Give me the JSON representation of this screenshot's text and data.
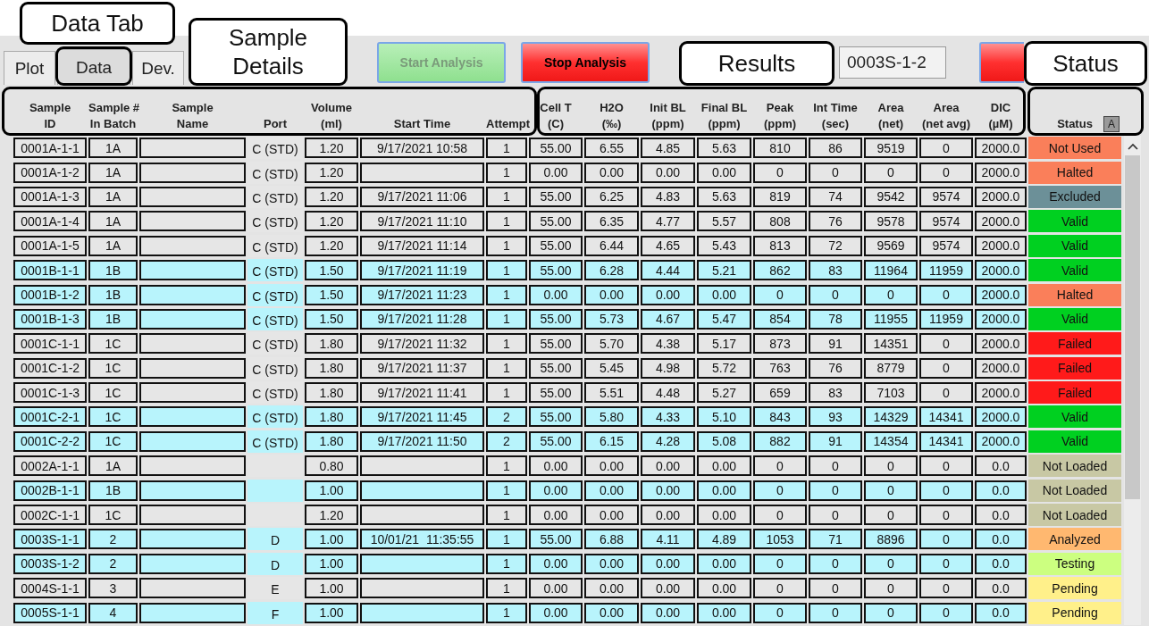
{
  "tabs": [
    {
      "label": "Plot",
      "selected": false
    },
    {
      "label": "Data",
      "selected": true
    },
    {
      "label": "Dev.",
      "selected": false
    }
  ],
  "buttons": [
    {
      "label": "Start Analysis",
      "kind": "green",
      "disabled": true
    },
    {
      "label": "Stop Analysis",
      "kind": "red",
      "disabled": false
    }
  ],
  "current_sample": {
    "value": "0003S-1-2"
  },
  "alarm_button": {
    "kind": "red"
  },
  "table": {
    "columns": [
      "Sample\nID",
      "Sample #\nIn Batch",
      "Sample\nName",
      "Port",
      "Volume\n(ml)",
      "Start Time",
      "Attempt",
      "Cell T\n(C)",
      "H2O\n(‰)",
      "Init BL\n(ppm)",
      "Final BL\n(ppm)",
      "Peak\n(ppm)",
      "Int Time\n(sec)",
      "Area\n(net)",
      "Area\n(net avg)",
      "DIC\n(µM)",
      "Status"
    ],
    "status_header_button": "A",
    "rows": [
      {
        "cells": [
          "0001A-1-1",
          "1A",
          null,
          "C (STD)",
          "1.20",
          "9/17/2021 10:58",
          "1",
          "55.00",
          "6.55",
          "4.85",
          "5.63",
          "810",
          "86",
          "9519",
          "0",
          "2000.0"
        ],
        "status": "Not Used",
        "color": "#fa7f5a",
        "highlighted": false
      },
      {
        "cells": [
          "0001A-1-2",
          "1A",
          null,
          "C (STD)",
          "1.20",
          null,
          "1",
          "0.00",
          "0.00",
          "0.00",
          "0.00",
          "0",
          "0",
          "0",
          "0",
          "2000.0"
        ],
        "status": "Halted",
        "color": "#fa7f5a",
        "highlighted": false
      },
      {
        "cells": [
          "0001A-1-3",
          "1A",
          null,
          "C (STD)",
          "1.20",
          "9/17/2021 11:06",
          "1",
          "55.00",
          "6.25",
          "4.83",
          "5.63",
          "819",
          "74",
          "9542",
          "9574",
          "2000.0"
        ],
        "status": "Excluded",
        "color": "#6c9098",
        "highlighted": false
      },
      {
        "cells": [
          "0001A-1-4",
          "1A",
          null,
          "C (STD)",
          "1.20",
          "9/17/2021 11:10",
          "1",
          "55.00",
          "6.35",
          "4.77",
          "5.57",
          "808",
          "76",
          "9578",
          "9574",
          "2000.0"
        ],
        "status": "Valid",
        "color": "#00d020",
        "highlighted": false
      },
      {
        "cells": [
          "0001A-1-5",
          "1A",
          null,
          "C (STD)",
          "1.20",
          "9/17/2021 11:14",
          "1",
          "55.00",
          "6.44",
          "4.65",
          "5.43",
          "813",
          "72",
          "9569",
          "9574",
          "2000.0"
        ],
        "status": "Valid",
        "color": "#00d020",
        "highlighted": false
      },
      {
        "cells": [
          "0001B-1-1",
          "1B",
          null,
          "C (STD)",
          "1.50",
          "9/17/2021 11:19",
          "1",
          "55.00",
          "6.28",
          "4.44",
          "5.21",
          "862",
          "83",
          "11964",
          "11959",
          "2000.0"
        ],
        "status": "Valid",
        "color": "#00d020",
        "highlighted": true
      },
      {
        "cells": [
          "0001B-1-2",
          "1B",
          null,
          "C (STD)",
          "1.50",
          "9/17/2021 11:23",
          "1",
          "0.00",
          "0.00",
          "0.00",
          "0.00",
          "0",
          "0",
          "0",
          "0",
          "2000.0"
        ],
        "status": "Halted",
        "color": "#fa7f5a",
        "highlighted": true
      },
      {
        "cells": [
          "0001B-1-3",
          "1B",
          null,
          "C (STD)",
          "1.50",
          "9/17/2021 11:28",
          "1",
          "55.00",
          "5.73",
          "4.67",
          "5.47",
          "854",
          "78",
          "11955",
          "11959",
          "2000.0"
        ],
        "status": "Valid",
        "color": "#00d020",
        "highlighted": true
      },
      {
        "cells": [
          "0001C-1-1",
          "1C",
          null,
          "C (STD)",
          "1.80",
          "9/17/2021 11:32",
          "1",
          "55.00",
          "5.70",
          "4.38",
          "5.17",
          "873",
          "91",
          "14351",
          "0",
          "2000.0"
        ],
        "status": "Failed",
        "color": "#ff1a1a",
        "highlighted": false
      },
      {
        "cells": [
          "0001C-1-2",
          "1C",
          null,
          "C (STD)",
          "1.80",
          "9/17/2021 11:37",
          "1",
          "55.00",
          "5.45",
          "4.98",
          "5.72",
          "763",
          "76",
          "8779",
          "0",
          "2000.0"
        ],
        "status": "Failed",
        "color": "#ff1a1a",
        "highlighted": false
      },
      {
        "cells": [
          "0001C-1-3",
          "1C",
          null,
          "C (STD)",
          "1.80",
          "9/17/2021 11:41",
          "1",
          "55.00",
          "5.51",
          "4.48",
          "5.27",
          "659",
          "83",
          "7103",
          "0",
          "2000.0"
        ],
        "status": "Failed",
        "color": "#ff1a1a",
        "highlighted": false
      },
      {
        "cells": [
          "0001C-2-1",
          "1C",
          null,
          "C (STD)",
          "1.80",
          "9/17/2021 11:45",
          "2",
          "55.00",
          "5.80",
          "4.33",
          "5.10",
          "843",
          "93",
          "14329",
          "14341",
          "2000.0"
        ],
        "status": "Valid",
        "color": "#00d020",
        "highlighted": true
      },
      {
        "cells": [
          "0001C-2-2",
          "1C",
          null,
          "C (STD)",
          "1.80",
          "9/17/2021 11:50",
          "2",
          "55.00",
          "6.15",
          "4.28",
          "5.08",
          "882",
          "91",
          "14354",
          "14341",
          "2000.0"
        ],
        "status": "Valid",
        "color": "#00d020",
        "highlighted": true
      },
      {
        "cells": [
          "0002A-1-1",
          "1A",
          null,
          null,
          "0.80",
          null,
          "1",
          "0.00",
          "0.00",
          "0.00",
          "0.00",
          "0",
          "0",
          "0",
          "0",
          "0.0"
        ],
        "status": "Not Loaded",
        "color": "#c8c8a4",
        "highlighted": false
      },
      {
        "cells": [
          "0002B-1-1",
          "1B",
          null,
          null,
          "1.00",
          null,
          "1",
          "0.00",
          "0.00",
          "0.00",
          "0.00",
          "0",
          "0",
          "0",
          "0",
          "0.0"
        ],
        "status": "Not Loaded",
        "color": "#c8c8a4",
        "highlighted": true
      },
      {
        "cells": [
          "0002C-1-1",
          "1C",
          null,
          null,
          "1.20",
          null,
          "1",
          "0.00",
          "0.00",
          "0.00",
          "0.00",
          "0",
          "0",
          "0",
          "0",
          "0.0"
        ],
        "status": "Not Loaded",
        "color": "#c8c8a4",
        "highlighted": false
      },
      {
        "cells": [
          "0003S-1-1",
          "2",
          null,
          "D",
          "1.00",
          "10/01/21  11:35:55",
          "1",
          "55.00",
          "6.88",
          "4.11",
          "4.89",
          "1053",
          "71",
          "8896",
          "0",
          "0.0"
        ],
        "status": "Analyzed",
        "color": "#ffb870",
        "highlighted": true
      },
      {
        "cells": [
          "0003S-1-2",
          "2",
          null,
          "D",
          "1.00",
          null,
          "1",
          "0.00",
          "0.00",
          "0.00",
          "0.00",
          "0",
          "0",
          "0",
          "0",
          "0.0"
        ],
        "status": "Testing",
        "color": "#ccff80",
        "highlighted": true
      },
      {
        "cells": [
          "0004S-1-1",
          "3",
          null,
          "E",
          "1.00",
          null,
          "1",
          "0.00",
          "0.00",
          "0.00",
          "0.00",
          "0",
          "0",
          "0",
          "0",
          "0.0"
        ],
        "status": "Pending",
        "color": "#fff08a",
        "highlighted": false
      },
      {
        "cells": [
          "0005S-1-1",
          "4",
          null,
          "F",
          "1.00",
          null,
          "1",
          "0.00",
          "0.00",
          "0.00",
          "0.00",
          "0",
          "0",
          "0",
          "0",
          "0.0"
        ],
        "status": "Pending",
        "color": "#fff08a",
        "highlighted": true
      }
    ]
  },
  "annotations": [
    {
      "label": "Data Tab"
    },
    {
      "label": "Sample Details"
    },
    {
      "label": "Results"
    },
    {
      "label": "Status"
    }
  ]
}
